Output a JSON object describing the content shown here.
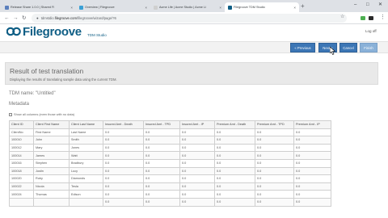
{
  "browser": {
    "tabs": [
      {
        "title": "Release Share 1.0.0 | Shared Fi",
        "color": "#5b7fbd",
        "active": false
      },
      {
        "title": "Overview | Filegroove",
        "color": "#3aa0d5",
        "active": false
      },
      {
        "title": "Acme Life | Acme Studio | Acme Li",
        "color": "#cfcfcf",
        "active": false
      },
      {
        "title": "Filegroove TDM Studio",
        "color": "#0f5e85",
        "active": true
      }
    ],
    "new_tab": "+",
    "controls": {
      "minimize": "–",
      "maximize": "□",
      "close": "✕"
    },
    "address": {
      "prefix": "tdmstdio.",
      "domain": "filegroove.com",
      "path": "/filegroove/wizard/page/?6"
    },
    "icons": {
      "back": "←",
      "forward": "→",
      "reload": "↻",
      "lock": "🔒",
      "star": "☆",
      "menu": "⋮"
    },
    "extension_colors": [
      "#4caf50",
      "#2a2a2a"
    ]
  },
  "app": {
    "logo": "Filegroove",
    "product": "TDM Studio",
    "logout": "Log off",
    "brand_color": "#0f5e85"
  },
  "actions": {
    "previous": "« Previous",
    "next": "Next »",
    "cancel": "Cancel",
    "finish": "Finish"
  },
  "main": {
    "title": "Result of test translation",
    "description": "Displaying the results of translating sample data using the current TDM.",
    "tdm_name": "TDM name: \"Untitled\"",
    "metadata": "Metadata",
    "show_all": "Show all columns (even those with no data)"
  },
  "table": {
    "columns": [
      "Client ID",
      "Client First Name",
      "Client Last Name",
      "Insured Amt - Death",
      "Insured Amt - TPD",
      "Insured Amt - IP",
      "Premium Amt - Death",
      "Premium Amt - TPD",
      "Premium Amt - IP"
    ],
    "rows": [
      [
        "ClientNo",
        "First Name",
        "Last Name",
        "0.0",
        "0.0",
        "0.0",
        "0.0",
        "0.0",
        "0.0"
      ],
      [
        "100010",
        "John",
        "Smith",
        "0.0",
        "0.0",
        "0.0",
        "0.0",
        "0.0",
        "0.0"
      ],
      [
        "100012",
        "Mary",
        "Jones",
        "0.0",
        "0.0",
        "0.0",
        "0.0",
        "0.0",
        "0.0"
      ],
      [
        "100014",
        "James",
        "Watt",
        "0.0",
        "0.0",
        "0.0",
        "0.0",
        "0.0",
        "0.0"
      ],
      [
        "100016",
        "Stephen",
        "Bradbury",
        "0.0",
        "0.0",
        "0.0",
        "0.0",
        "0.0",
        "0.0"
      ],
      [
        "100018",
        "Justin",
        "Lucy",
        "0.0",
        "0.0",
        "0.0",
        "0.0",
        "0.0",
        "0.0"
      ],
      [
        "100020",
        "Ruby",
        "Diamonds",
        "0.0",
        "0.0",
        "0.0",
        "0.0",
        "0.0",
        "0.0"
      ],
      [
        "100022",
        "Nicola",
        "Tesla",
        "0.0",
        "0.0",
        "0.0",
        "0.0",
        "0.0",
        "0.0"
      ],
      [
        "100024",
        "Thomas",
        "Edison",
        "0.0",
        "0.0",
        "0.0",
        "0.0",
        "0.0",
        "0.0"
      ],
      [
        "",
        "",
        "",
        "0.0",
        "0.0",
        "0.0",
        "0.0",
        "0.0",
        "0.0"
      ]
    ]
  }
}
